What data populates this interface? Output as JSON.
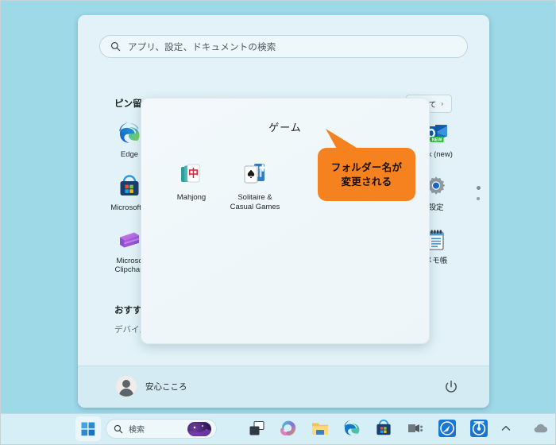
{
  "desktop": {
    "background_color": "#9ed9e8"
  },
  "start_menu": {
    "search": {
      "placeholder": "アプリ、設定、ドキュメントの検索",
      "icon": "search-icon",
      "value": ""
    },
    "pinned": {
      "heading": "ピン留め済み",
      "all_apps_button": {
        "label": "すべて",
        "chevron": "›"
      },
      "apps": [
        {
          "name": "Edge",
          "label": "Edge",
          "icon": "edge-icon"
        },
        {
          "name": "Microsoft Store",
          "label": "Microsoft S",
          "icon": "microsoft-store-icon"
        },
        {
          "name": "Microsoft Clipchamp",
          "label_line1": "Microso",
          "label_line2": "Clipchan",
          "icon": "clipchamp-icon"
        },
        {
          "name": "Outlook (new)",
          "label": "ook (new)",
          "icon": "outlook-new-icon",
          "badge": "NEW"
        },
        {
          "name": "設定",
          "label": "設定",
          "icon": "settings-gear-icon"
        },
        {
          "name": "メモ帳",
          "label": "メモ帳",
          "icon": "notepad-icon"
        }
      ],
      "page_dots": {
        "count": 2,
        "active_index": 0
      }
    },
    "recommended": {
      "heading": "おすす",
      "subtext": "デバイス"
    },
    "account": {
      "user_name": "安心こころ",
      "avatar_icon": "user-avatar-icon",
      "power_icon": "power-icon"
    }
  },
  "folder_popup": {
    "title": "ゲーム",
    "apps": [
      {
        "name": "Mahjong",
        "label": "Mahjong",
        "icon": "mahjong-icon"
      },
      {
        "name": "Solitaire & Casual Games",
        "label_line1": "Solitaire &",
        "label_line2": "Casual Games",
        "icon": "solitaire-icon"
      }
    ]
  },
  "callout": {
    "color": "#f5821f",
    "line1": "フォルダー名が",
    "line2": "変更される"
  },
  "taskbar": {
    "start_button": {
      "icon": "windows-start-icon"
    },
    "search": {
      "placeholder": "検索",
      "icon": "search-icon",
      "thumbnail": "search-highlight-thumbnail"
    },
    "items": [
      {
        "name": "Task View",
        "icon": "task-view-icon"
      },
      {
        "name": "Copilot",
        "icon": "copilot-icon"
      },
      {
        "name": "File Explorer",
        "icon": "file-explorer-icon"
      },
      {
        "name": "Microsoft Edge",
        "icon": "edge-icon"
      },
      {
        "name": "Microsoft Store",
        "icon": "microsoft-store-icon"
      },
      {
        "name": "Media App",
        "icon": "media-app-icon"
      },
      {
        "name": "Blue App 1",
        "icon": "blue-circle-app-icon"
      },
      {
        "name": "Blue App 2",
        "icon": "blue-dial-app-icon"
      }
    ],
    "tray": [
      {
        "name": "Show hidden icons",
        "icon": "chevron-up-icon"
      },
      {
        "name": "OneDrive",
        "icon": "cloud-icon"
      }
    ]
  }
}
